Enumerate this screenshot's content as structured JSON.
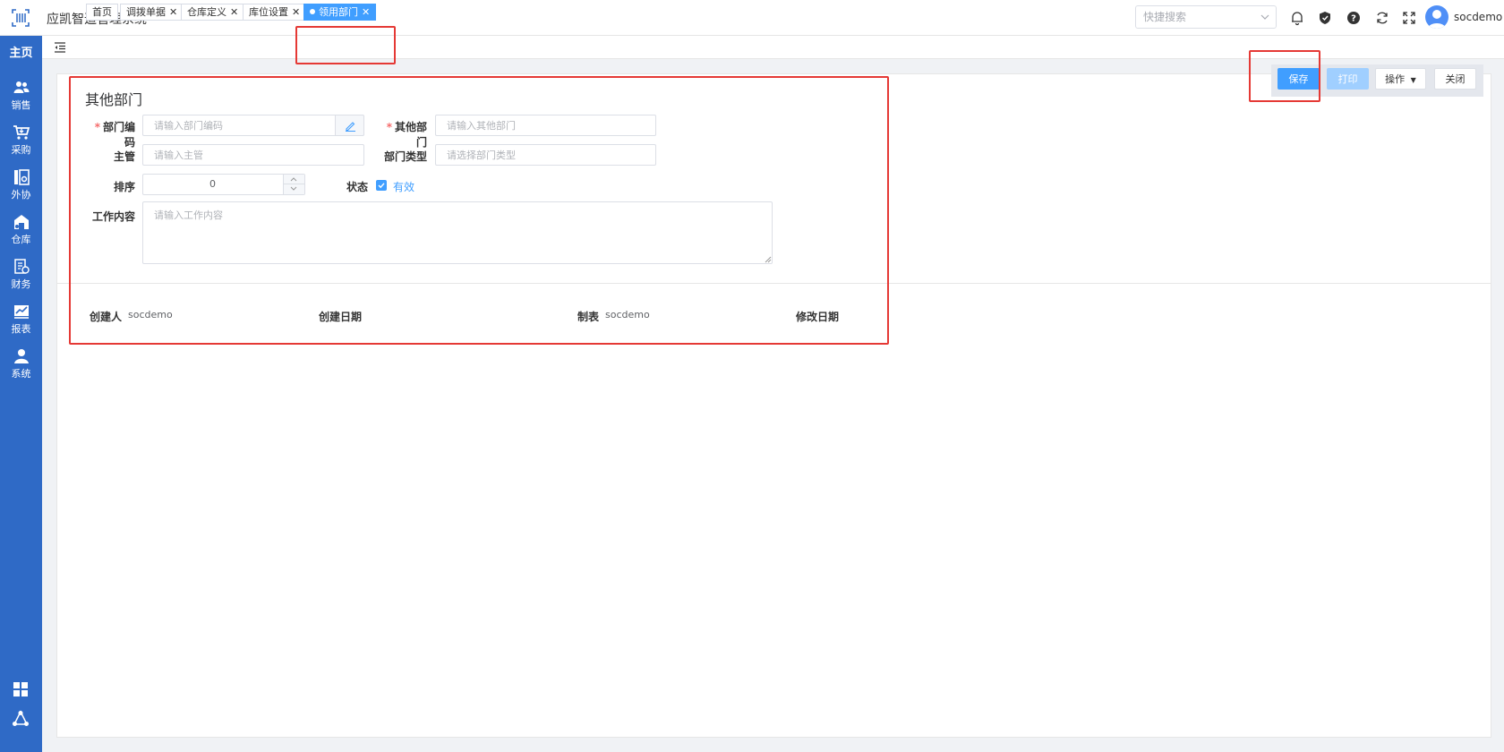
{
  "app": {
    "title": "应凯智造管理系统"
  },
  "header": {
    "search_placeholder": "快捷搜索",
    "username": "socdemo",
    "icons": [
      "bell-icon",
      "shield-icon",
      "help-icon",
      "refresh-icon",
      "fullscreen-icon"
    ]
  },
  "sidebar": {
    "home": "主页",
    "items": [
      {
        "label": "销售",
        "icon": "users-icon"
      },
      {
        "label": "采购",
        "icon": "cart-icon"
      },
      {
        "label": "外协",
        "icon": "outsource-icon"
      },
      {
        "label": "仓库",
        "icon": "warehouse-icon"
      },
      {
        "label": "财务",
        "icon": "finance-icon"
      },
      {
        "label": "报表",
        "icon": "report-icon"
      },
      {
        "label": "系统",
        "icon": "user-icon"
      }
    ],
    "bottom_icons": [
      "grid-icon",
      "network-icon"
    ]
  },
  "tabs": [
    {
      "label": "首页",
      "closable": false
    },
    {
      "label": "调拨单据",
      "closable": true
    },
    {
      "label": "仓库定义",
      "closable": true
    },
    {
      "label": "库位设置",
      "closable": true
    },
    {
      "label": "领用部门",
      "closable": true,
      "active": true
    }
  ],
  "toolbar": {
    "save": "保存",
    "print": "打印",
    "ops": "操作",
    "close": "关闭"
  },
  "form": {
    "title": "其他部门",
    "dept_code_label": "部门编码",
    "dept_code_placeholder": "请输入部门编码",
    "other_dept_label": "其他部门",
    "other_dept_placeholder": "请输入其他部门",
    "manager_label": "主管",
    "manager_placeholder": "请输入主管",
    "dept_type_label": "部门类型",
    "dept_type_placeholder": "请选择部门类型",
    "sort_label": "排序",
    "sort_value": "0",
    "status_label": "状态",
    "status_value": "有效",
    "status_checked": true,
    "work_label": "工作内容",
    "work_placeholder": "请输入工作内容"
  },
  "meta": {
    "creator_label": "创建人",
    "creator_value": "socdemo",
    "created_date_label": "创建日期",
    "created_date_value": "",
    "maker_label": "制表",
    "maker_value": "socdemo",
    "modified_date_label": "修改日期",
    "modified_date_value": ""
  },
  "colors": {
    "primary": "#409eff",
    "sidebar": "#2f6ac6",
    "highlight": "#e53935",
    "required": "#f56c6c"
  }
}
